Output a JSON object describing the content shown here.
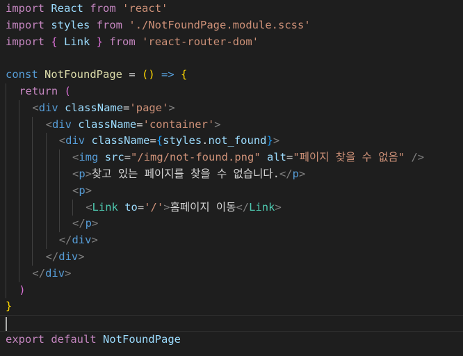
{
  "editor": {
    "lines": [
      {
        "tokens": [
          {
            "t": "import",
            "c": "kw-flow"
          },
          {
            "t": " ",
            "c": "txt"
          },
          {
            "t": "React",
            "c": "var"
          },
          {
            "t": " ",
            "c": "txt"
          },
          {
            "t": "from",
            "c": "kw-flow"
          },
          {
            "t": " ",
            "c": "txt"
          },
          {
            "t": "'react'",
            "c": "str"
          }
        ]
      },
      {
        "tokens": [
          {
            "t": "import",
            "c": "kw-flow"
          },
          {
            "t": " ",
            "c": "txt"
          },
          {
            "t": "styles",
            "c": "var"
          },
          {
            "t": " ",
            "c": "txt"
          },
          {
            "t": "from",
            "c": "kw-flow"
          },
          {
            "t": " ",
            "c": "txt"
          },
          {
            "t": "'./NotFoundPage.module.scss'",
            "c": "str"
          }
        ]
      },
      {
        "tokens": [
          {
            "t": "import",
            "c": "kw-flow"
          },
          {
            "t": " ",
            "c": "txt"
          },
          {
            "t": "{",
            "c": "br2"
          },
          {
            "t": " ",
            "c": "txt"
          },
          {
            "t": "Link",
            "c": "var"
          },
          {
            "t": " ",
            "c": "txt"
          },
          {
            "t": "}",
            "c": "br2"
          },
          {
            "t": " ",
            "c": "txt"
          },
          {
            "t": "from",
            "c": "kw-flow"
          },
          {
            "t": " ",
            "c": "txt"
          },
          {
            "t": "'react-router-dom'",
            "c": "str"
          }
        ]
      },
      {
        "tokens": []
      },
      {
        "tokens": [
          {
            "t": "const",
            "c": "kw"
          },
          {
            "t": " ",
            "c": "txt"
          },
          {
            "t": "NotFoundPage",
            "c": "fn"
          },
          {
            "t": " = ",
            "c": "op"
          },
          {
            "t": "()",
            "c": "br1"
          },
          {
            "t": " ",
            "c": "txt"
          },
          {
            "t": "=>",
            "c": "kw"
          },
          {
            "t": " ",
            "c": "txt"
          },
          {
            "t": "{",
            "c": "br1"
          }
        ]
      },
      {
        "indent": 1,
        "tokens": [
          {
            "t": "return",
            "c": "kw-flow"
          },
          {
            "t": " ",
            "c": "txt"
          },
          {
            "t": "(",
            "c": "br2"
          }
        ]
      },
      {
        "indent": 2,
        "tokens": [
          {
            "t": "<",
            "c": "punct-tag"
          },
          {
            "t": "div",
            "c": "tag"
          },
          {
            "t": " ",
            "c": "txt"
          },
          {
            "t": "className",
            "c": "attr"
          },
          {
            "t": "=",
            "c": "op"
          },
          {
            "t": "'page'",
            "c": "str"
          },
          {
            "t": ">",
            "c": "punct-tag"
          }
        ]
      },
      {
        "indent": 3,
        "tokens": [
          {
            "t": "<",
            "c": "punct-tag"
          },
          {
            "t": "div",
            "c": "tag"
          },
          {
            "t": " ",
            "c": "txt"
          },
          {
            "t": "className",
            "c": "attr"
          },
          {
            "t": "=",
            "c": "op"
          },
          {
            "t": "'container'",
            "c": "str"
          },
          {
            "t": ">",
            "c": "punct-tag"
          }
        ]
      },
      {
        "indent": 4,
        "tokens": [
          {
            "t": "<",
            "c": "punct-tag"
          },
          {
            "t": "div",
            "c": "tag"
          },
          {
            "t": " ",
            "c": "txt"
          },
          {
            "t": "className",
            "c": "attr"
          },
          {
            "t": "=",
            "c": "op"
          },
          {
            "t": "{",
            "c": "br3"
          },
          {
            "t": "styles",
            "c": "var"
          },
          {
            "t": ".",
            "c": "op"
          },
          {
            "t": "not_found",
            "c": "var"
          },
          {
            "t": "}",
            "c": "br3"
          },
          {
            "t": ">",
            "c": "punct-tag"
          }
        ]
      },
      {
        "indent": 5,
        "tokens": [
          {
            "t": "<",
            "c": "punct-tag"
          },
          {
            "t": "img",
            "c": "tag"
          },
          {
            "t": " ",
            "c": "txt"
          },
          {
            "t": "src",
            "c": "attr"
          },
          {
            "t": "=",
            "c": "op"
          },
          {
            "t": "\"/img/not-found.png\"",
            "c": "str"
          },
          {
            "t": " ",
            "c": "txt"
          },
          {
            "t": "alt",
            "c": "attr"
          },
          {
            "t": "=",
            "c": "op"
          },
          {
            "t": "\"페이지 찾을 수 없음\"",
            "c": "str"
          },
          {
            "t": " ",
            "c": "txt"
          },
          {
            "t": "/>",
            "c": "punct-tag"
          }
        ]
      },
      {
        "indent": 5,
        "tokens": [
          {
            "t": "<",
            "c": "punct-tag"
          },
          {
            "t": "p",
            "c": "tag"
          },
          {
            "t": ">",
            "c": "punct-tag"
          },
          {
            "t": "찾고 있는 페이지를 찾을 수 없습니다.",
            "c": "txt"
          },
          {
            "t": "</",
            "c": "punct-tag"
          },
          {
            "t": "p",
            "c": "tag"
          },
          {
            "t": ">",
            "c": "punct-tag"
          }
        ]
      },
      {
        "indent": 5,
        "tokens": [
          {
            "t": "<",
            "c": "punct-tag"
          },
          {
            "t": "p",
            "c": "tag"
          },
          {
            "t": ">",
            "c": "punct-tag"
          }
        ]
      },
      {
        "indent": 6,
        "tokens": [
          {
            "t": "<",
            "c": "punct-tag"
          },
          {
            "t": "Link",
            "c": "cls"
          },
          {
            "t": " ",
            "c": "txt"
          },
          {
            "t": "to",
            "c": "attr"
          },
          {
            "t": "=",
            "c": "op"
          },
          {
            "t": "'/'",
            "c": "str"
          },
          {
            "t": ">",
            "c": "punct-tag"
          },
          {
            "t": "홈페이지 이동",
            "c": "txt"
          },
          {
            "t": "</",
            "c": "punct-tag"
          },
          {
            "t": "Link",
            "c": "cls"
          },
          {
            "t": ">",
            "c": "punct-tag"
          }
        ]
      },
      {
        "indent": 5,
        "tokens": [
          {
            "t": "</",
            "c": "punct-tag"
          },
          {
            "t": "p",
            "c": "tag"
          },
          {
            "t": ">",
            "c": "punct-tag"
          }
        ]
      },
      {
        "indent": 4,
        "tokens": [
          {
            "t": "</",
            "c": "punct-tag"
          },
          {
            "t": "div",
            "c": "tag"
          },
          {
            "t": ">",
            "c": "punct-tag"
          }
        ]
      },
      {
        "indent": 3,
        "tokens": [
          {
            "t": "</",
            "c": "punct-tag"
          },
          {
            "t": "div",
            "c": "tag"
          },
          {
            "t": ">",
            "c": "punct-tag"
          }
        ]
      },
      {
        "indent": 2,
        "tokens": [
          {
            "t": "</",
            "c": "punct-tag"
          },
          {
            "t": "div",
            "c": "tag"
          },
          {
            "t": ">",
            "c": "punct-tag"
          }
        ]
      },
      {
        "indent": 1,
        "tokens": [
          {
            "t": ")",
            "c": "br2"
          }
        ]
      },
      {
        "tokens": [
          {
            "t": "}",
            "c": "br1"
          }
        ]
      },
      {
        "current": true,
        "tokens": []
      },
      {
        "tokens": [
          {
            "t": "export",
            "c": "kw-flow"
          },
          {
            "t": " ",
            "c": "txt"
          },
          {
            "t": "default",
            "c": "kw-flow"
          },
          {
            "t": " ",
            "c": "txt"
          },
          {
            "t": "NotFoundPage",
            "c": "var"
          }
        ]
      }
    ]
  }
}
